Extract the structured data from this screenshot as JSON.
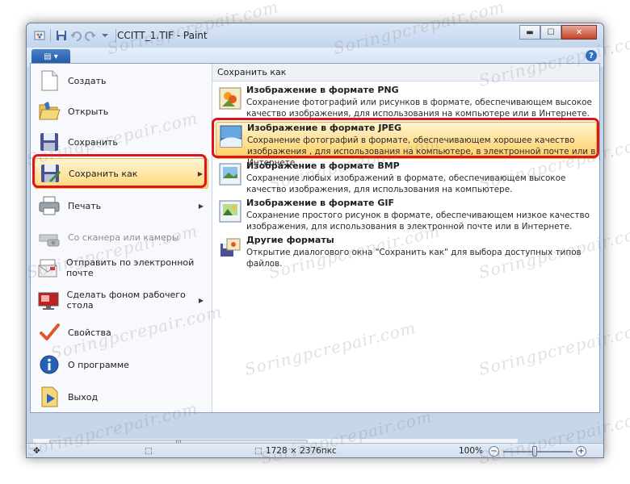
{
  "window": {
    "title": "CCITT_1.TIF - Paint",
    "help_label": "?",
    "buttons": {
      "minimize": "▬",
      "maximize": "☐",
      "close": "✕"
    }
  },
  "app_button_label": "▤ ▾",
  "menu": {
    "items": [
      {
        "label": "Создать",
        "icon": "new-document-icon"
      },
      {
        "label": "Открыть",
        "icon": "open-folder-icon"
      },
      {
        "label": "Сохранить",
        "icon": "save-disk-icon"
      },
      {
        "label": "Сохранить как",
        "icon": "save-as-icon",
        "submenu": true,
        "active": true
      },
      {
        "label": "Печать",
        "icon": "printer-icon",
        "submenu": true
      },
      {
        "label": "Со сканера или камеры",
        "icon": "scanner-icon",
        "disabled": true
      },
      {
        "label": "Отправить по электронной почте",
        "icon": "email-icon"
      },
      {
        "label": "Сделать фоном рабочего стола",
        "icon": "desktop-background-icon",
        "submenu": true
      },
      {
        "label": "Свойства",
        "icon": "checkmark-icon"
      },
      {
        "label": "О программе",
        "icon": "info-icon"
      },
      {
        "label": "Выход",
        "icon": "exit-icon"
      }
    ],
    "submenu_arrow": "▶"
  },
  "save_as": {
    "header": "Сохранить как",
    "formats": [
      {
        "title": "Изображение в формате PNG",
        "desc": "Сохранение фотографий или рисунков в формате, обеспечивающем высокое качество изображения, для использования на компьютере или в Интернете.",
        "icon": "png-image-icon"
      },
      {
        "title": "Изображение в формате JPEG",
        "desc": "Сохранение фотографий в формате, обеспечивающем хорошее качество изображения , для использования на компьютере, в электронной почте или в Интернете.",
        "icon": "jpeg-image-icon",
        "selected": true
      },
      {
        "title": "Изображение в формате BMP",
        "desc": "Сохранение любых изображений в формате, обеспечивающем высокое качество изображения, для использования на компьютере.",
        "icon": "bmp-image-icon"
      },
      {
        "title": "Изображение в формате GIF",
        "desc": "Сохранение простого рисунок в формате, обеспечивающем низкое качество изображения, для использования в электронной почте или в Интернете.",
        "icon": "gif-image-icon"
      },
      {
        "title": "Другие форматы",
        "desc": "Открытие диалогового окна \"Сохранить как\" для выбора доступных типов файлов.",
        "icon": "other-formats-icon"
      }
    ]
  },
  "status": {
    "dimensions": "1728 × 2376пкс",
    "zoom": "100%",
    "zoom_out": "−",
    "zoom_in": "+",
    "move_glyph": "✥",
    "select_glyph": "⬚",
    "scroll_grip": "|||"
  },
  "watermark": "Soringpcrepair.com",
  "colors": {
    "highlight_red": "#e0141b",
    "accent_blue": "#1f58a6",
    "selected_bg": "#ffd979"
  }
}
